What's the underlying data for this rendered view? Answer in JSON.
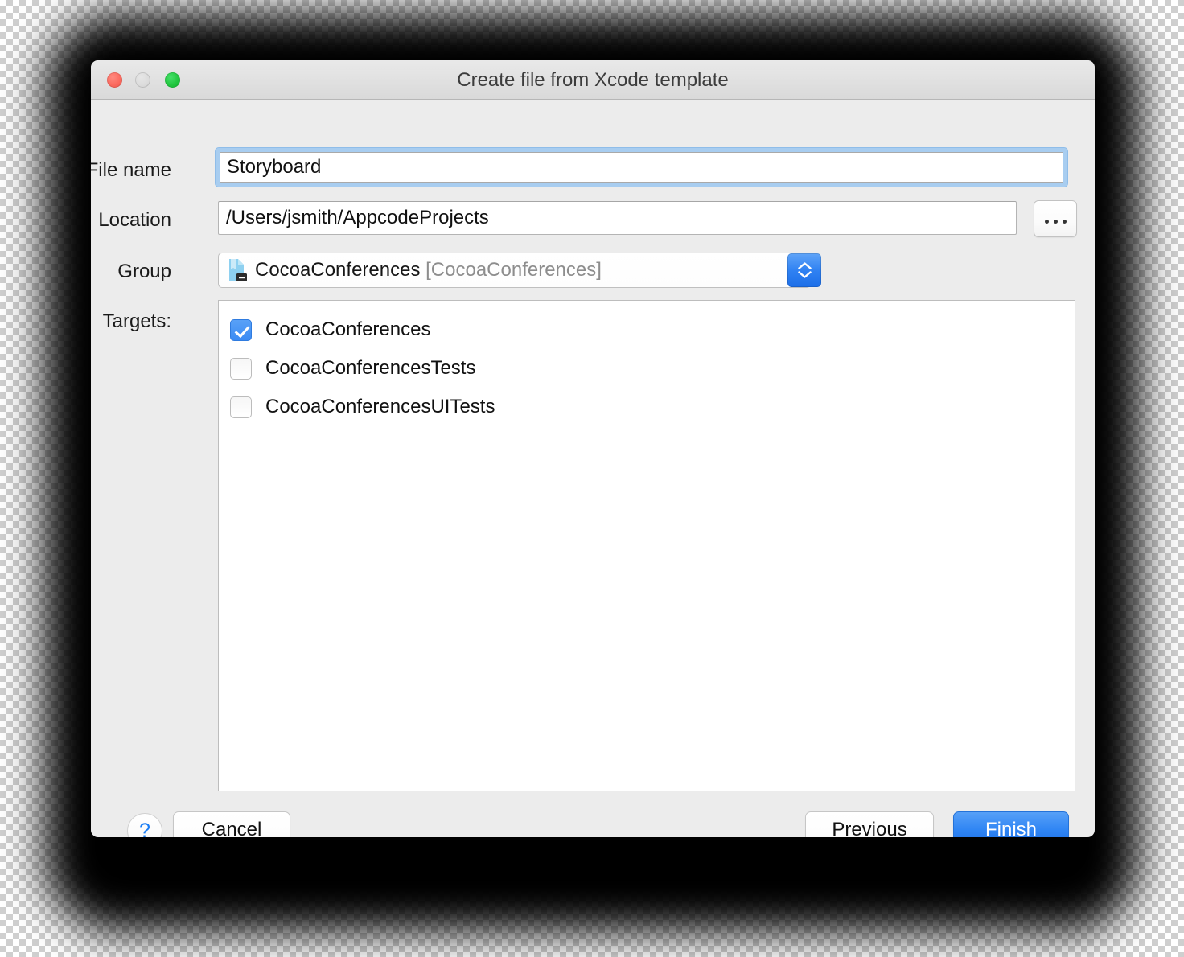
{
  "window": {
    "title": "Create file from Xcode template",
    "traffic_lights": [
      "close",
      "minimize",
      "zoom"
    ]
  },
  "form": {
    "filename": {
      "label": "File name",
      "value": "Storyboard",
      "placeholder": ""
    },
    "location": {
      "label": "Location",
      "value": "/Users/jsmith/AppcodeProjects",
      "placeholder": "",
      "browse_label": "..."
    },
    "group": {
      "label": "Group",
      "value": "CocoaConferences",
      "module": "[CocoaConferences]",
      "icon": "xcode-group-icon"
    },
    "targets": {
      "label": "Targets:",
      "items": [
        {
          "name": "CocoaConferences",
          "checked": true
        },
        {
          "name": "CocoaConferencesTests",
          "checked": false
        },
        {
          "name": "CocoaConferencesUITests",
          "checked": false
        }
      ]
    }
  },
  "footer": {
    "help_label": "?",
    "cancel_label": "Cancel",
    "previous_label": "Previous",
    "finish_label": "Finish"
  },
  "colors": {
    "accent": "#2f85f4",
    "focus_ring": "#a8cdf0",
    "window_bg": "#ececec",
    "dim_text": "#8d8d8d"
  }
}
